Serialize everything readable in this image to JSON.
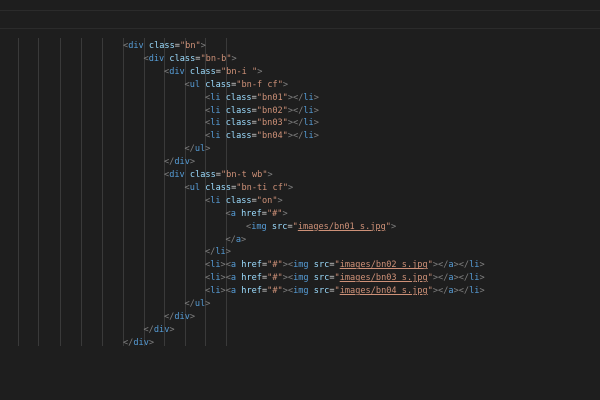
{
  "colors": {
    "background": "#1e1e1e",
    "tag": "#569cd6",
    "attribute": "#9cdcfe",
    "string": "#ce9178",
    "bracket": "#808080"
  },
  "code_lines": [
    {
      "indent": 0,
      "tokens": [
        [
          "br",
          "<"
        ],
        [
          "tag",
          "div"
        ],
        [
          "sp",
          " "
        ],
        [
          "attr",
          "class"
        ],
        [
          "eq",
          "="
        ],
        [
          "str",
          "\"bn\""
        ],
        [
          "br",
          ">"
        ]
      ]
    },
    {
      "indent": 1,
      "tokens": [
        [
          "br",
          "<"
        ],
        [
          "tag",
          "div"
        ],
        [
          "sp",
          " "
        ],
        [
          "attr",
          "class"
        ],
        [
          "eq",
          "="
        ],
        [
          "str",
          "\"bn-b\""
        ],
        [
          "br",
          ">"
        ]
      ]
    },
    {
      "indent": 2,
      "tokens": [
        [
          "br",
          "<"
        ],
        [
          "tag",
          "div"
        ],
        [
          "sp",
          " "
        ],
        [
          "attr",
          "class"
        ],
        [
          "eq",
          "="
        ],
        [
          "str",
          "\"bn-i \""
        ],
        [
          "br",
          ">"
        ]
      ]
    },
    {
      "indent": 3,
      "tokens": [
        [
          "br",
          "<"
        ],
        [
          "tag",
          "ul"
        ],
        [
          "sp",
          " "
        ],
        [
          "attr",
          "class"
        ],
        [
          "eq",
          "="
        ],
        [
          "str",
          "\"bn-f cf\""
        ],
        [
          "br",
          ">"
        ]
      ]
    },
    {
      "indent": 4,
      "tokens": [
        [
          "br",
          "<"
        ],
        [
          "tag",
          "li"
        ],
        [
          "sp",
          " "
        ],
        [
          "attr",
          "class"
        ],
        [
          "eq",
          "="
        ],
        [
          "str",
          "\"bn01\""
        ],
        [
          "br",
          "></"
        ],
        [
          "tag",
          "li"
        ],
        [
          "br",
          ">"
        ]
      ]
    },
    {
      "indent": 4,
      "tokens": [
        [
          "br",
          "<"
        ],
        [
          "tag",
          "li"
        ],
        [
          "sp",
          " "
        ],
        [
          "attr",
          "class"
        ],
        [
          "eq",
          "="
        ],
        [
          "str",
          "\"bn02\""
        ],
        [
          "br",
          "></"
        ],
        [
          "tag",
          "li"
        ],
        [
          "br",
          ">"
        ]
      ]
    },
    {
      "indent": 4,
      "tokens": [
        [
          "br",
          "<"
        ],
        [
          "tag",
          "li"
        ],
        [
          "sp",
          " "
        ],
        [
          "attr",
          "class"
        ],
        [
          "eq",
          "="
        ],
        [
          "str",
          "\"bn03\""
        ],
        [
          "br",
          "></"
        ],
        [
          "tag",
          "li"
        ],
        [
          "br",
          ">"
        ]
      ]
    },
    {
      "indent": 4,
      "tokens": [
        [
          "br",
          "<"
        ],
        [
          "tag",
          "li"
        ],
        [
          "sp",
          " "
        ],
        [
          "attr",
          "class"
        ],
        [
          "eq",
          "="
        ],
        [
          "str",
          "\"bn04\""
        ],
        [
          "br",
          "></"
        ],
        [
          "tag",
          "li"
        ],
        [
          "br",
          ">"
        ]
      ]
    },
    {
      "indent": 3,
      "tokens": [
        [
          "br",
          "</"
        ],
        [
          "tag",
          "ul"
        ],
        [
          "br",
          ">"
        ]
      ]
    },
    {
      "indent": 2,
      "tokens": [
        [
          "br",
          "</"
        ],
        [
          "tag",
          "div"
        ],
        [
          "br",
          ">"
        ]
      ]
    },
    {
      "indent": 2,
      "tokens": [
        [
          "br",
          "<"
        ],
        [
          "tag",
          "div"
        ],
        [
          "sp",
          " "
        ],
        [
          "attr",
          "class"
        ],
        [
          "eq",
          "="
        ],
        [
          "str",
          "\"bn-t wb\""
        ],
        [
          "br",
          ">"
        ]
      ]
    },
    {
      "indent": 3,
      "tokens": [
        [
          "br",
          "<"
        ],
        [
          "tag",
          "ul"
        ],
        [
          "sp",
          " "
        ],
        [
          "attr",
          "class"
        ],
        [
          "eq",
          "="
        ],
        [
          "str",
          "\"bn-ti cf\""
        ],
        [
          "br",
          ">"
        ]
      ]
    },
    {
      "indent": 4,
      "tokens": [
        [
          "br",
          "<"
        ],
        [
          "tag",
          "li"
        ],
        [
          "sp",
          " "
        ],
        [
          "attr",
          "class"
        ],
        [
          "eq",
          "="
        ],
        [
          "str",
          "\"on\""
        ],
        [
          "br",
          ">"
        ]
      ]
    },
    {
      "indent": 5,
      "tokens": [
        [
          "br",
          "<"
        ],
        [
          "tag",
          "a"
        ],
        [
          "sp",
          " "
        ],
        [
          "attr",
          "href"
        ],
        [
          "eq",
          "="
        ],
        [
          "str",
          "\"#\""
        ],
        [
          "br",
          ">"
        ]
      ]
    },
    {
      "indent": 6,
      "tokens": [
        [
          "br",
          "<"
        ],
        [
          "tag",
          "img"
        ],
        [
          "sp",
          " "
        ],
        [
          "attr",
          "src"
        ],
        [
          "eq",
          "="
        ],
        [
          "str",
          "\""
        ],
        [
          "link",
          "images/bn01_s.jpg"
        ],
        [
          "str",
          "\""
        ],
        [
          "br",
          ">"
        ]
      ]
    },
    {
      "indent": 5,
      "tokens": [
        [
          "br",
          "</"
        ],
        [
          "tag",
          "a"
        ],
        [
          "br",
          ">"
        ]
      ]
    },
    {
      "indent": 4,
      "tokens": [
        [
          "br",
          "</"
        ],
        [
          "tag",
          "li"
        ],
        [
          "br",
          ">"
        ]
      ]
    },
    {
      "indent": 4,
      "tokens": [
        [
          "br",
          "<"
        ],
        [
          "tag",
          "li"
        ],
        [
          "br",
          "><"
        ],
        [
          "tag",
          "a"
        ],
        [
          "sp",
          " "
        ],
        [
          "attr",
          "href"
        ],
        [
          "eq",
          "="
        ],
        [
          "str",
          "\"#\""
        ],
        [
          "br",
          "><"
        ],
        [
          "tag",
          "img"
        ],
        [
          "sp",
          " "
        ],
        [
          "attr",
          "src"
        ],
        [
          "eq",
          "="
        ],
        [
          "str",
          "\""
        ],
        [
          "link",
          "images/bn02_s.jpg"
        ],
        [
          "str",
          "\""
        ],
        [
          "br",
          "></"
        ],
        [
          "tag",
          "a"
        ],
        [
          "br",
          "></"
        ],
        [
          "tag",
          "li"
        ],
        [
          "br",
          ">"
        ]
      ]
    },
    {
      "indent": 4,
      "tokens": [
        [
          "br",
          "<"
        ],
        [
          "tag",
          "li"
        ],
        [
          "br",
          "><"
        ],
        [
          "tag",
          "a"
        ],
        [
          "sp",
          " "
        ],
        [
          "attr",
          "href"
        ],
        [
          "eq",
          "="
        ],
        [
          "str",
          "\"#\""
        ],
        [
          "br",
          "><"
        ],
        [
          "tag",
          "img"
        ],
        [
          "sp",
          " "
        ],
        [
          "attr",
          "src"
        ],
        [
          "eq",
          "="
        ],
        [
          "str",
          "\""
        ],
        [
          "link",
          "images/bn03_s.jpg"
        ],
        [
          "str",
          "\""
        ],
        [
          "br",
          "></"
        ],
        [
          "tag",
          "a"
        ],
        [
          "br",
          "></"
        ],
        [
          "tag",
          "li"
        ],
        [
          "br",
          ">"
        ]
      ]
    },
    {
      "indent": 4,
      "tokens": [
        [
          "br",
          "<"
        ],
        [
          "tag",
          "li"
        ],
        [
          "br",
          "><"
        ],
        [
          "tag",
          "a"
        ],
        [
          "sp",
          " "
        ],
        [
          "attr",
          "href"
        ],
        [
          "eq",
          "="
        ],
        [
          "str",
          "\"#\""
        ],
        [
          "br",
          "><"
        ],
        [
          "tag",
          "img"
        ],
        [
          "sp",
          " "
        ],
        [
          "attr",
          "src"
        ],
        [
          "eq",
          "="
        ],
        [
          "str",
          "\""
        ],
        [
          "link",
          "images/bn04_s.jpg"
        ],
        [
          "str",
          "\""
        ],
        [
          "br",
          "></"
        ],
        [
          "tag",
          "a"
        ],
        [
          "br",
          "></"
        ],
        [
          "tag",
          "li"
        ],
        [
          "br",
          ">"
        ]
      ]
    },
    {
      "indent": 3,
      "tokens": [
        [
          "br",
          "</"
        ],
        [
          "tag",
          "ul"
        ],
        [
          "br",
          ">"
        ]
      ]
    },
    {
      "indent": 2,
      "tokens": [
        [
          "br",
          "</"
        ],
        [
          "tag",
          "div"
        ],
        [
          "br",
          ">"
        ]
      ]
    },
    {
      "indent": 1,
      "tokens": [
        [
          "br",
          "</"
        ],
        [
          "tag",
          "div"
        ],
        [
          "br",
          ">"
        ]
      ]
    },
    {
      "indent": 0,
      "tokens": [
        [
          "br",
          "</"
        ],
        [
          "tag",
          "div"
        ],
        [
          "br",
          ">"
        ]
      ]
    }
  ]
}
